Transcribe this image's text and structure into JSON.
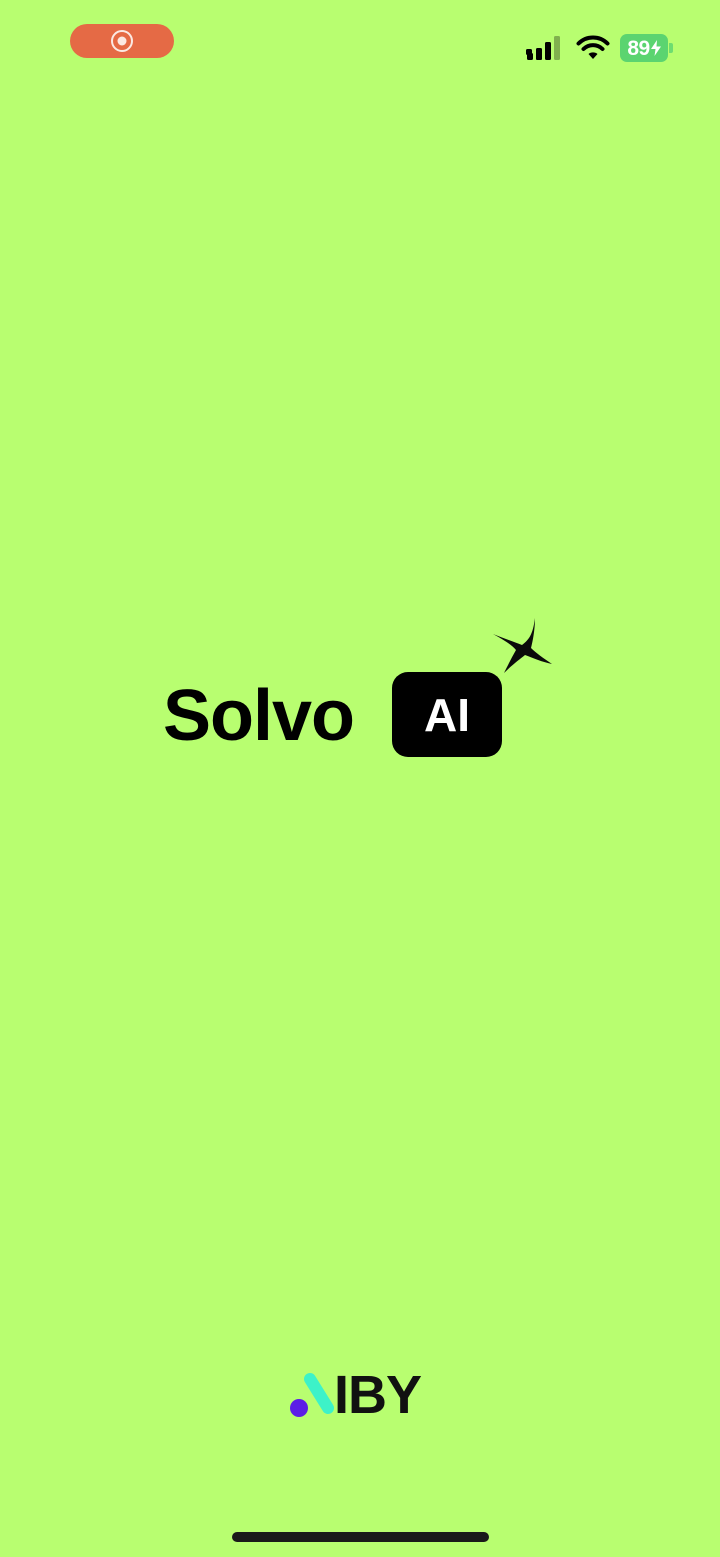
{
  "status_bar": {
    "battery_level": "89",
    "recording_indicator": "screen-recording-icon",
    "signal_icon": "cellular-signal-icon",
    "wifi_icon": "wifi-icon",
    "battery_icon": "battery-charging-icon"
  },
  "splash": {
    "wordmark": "Solvo",
    "badge_label": "AI",
    "sparkle_icon": "sparkle-icon"
  },
  "publisher": {
    "name": "IBY"
  },
  "colors": {
    "background": "#b8fe70",
    "recording_pill": "#e56a45",
    "battery": "#5bd470",
    "badge": "#000000",
    "publisher_dot": "#5b1ee6",
    "publisher_stroke": "#3df2c8"
  }
}
